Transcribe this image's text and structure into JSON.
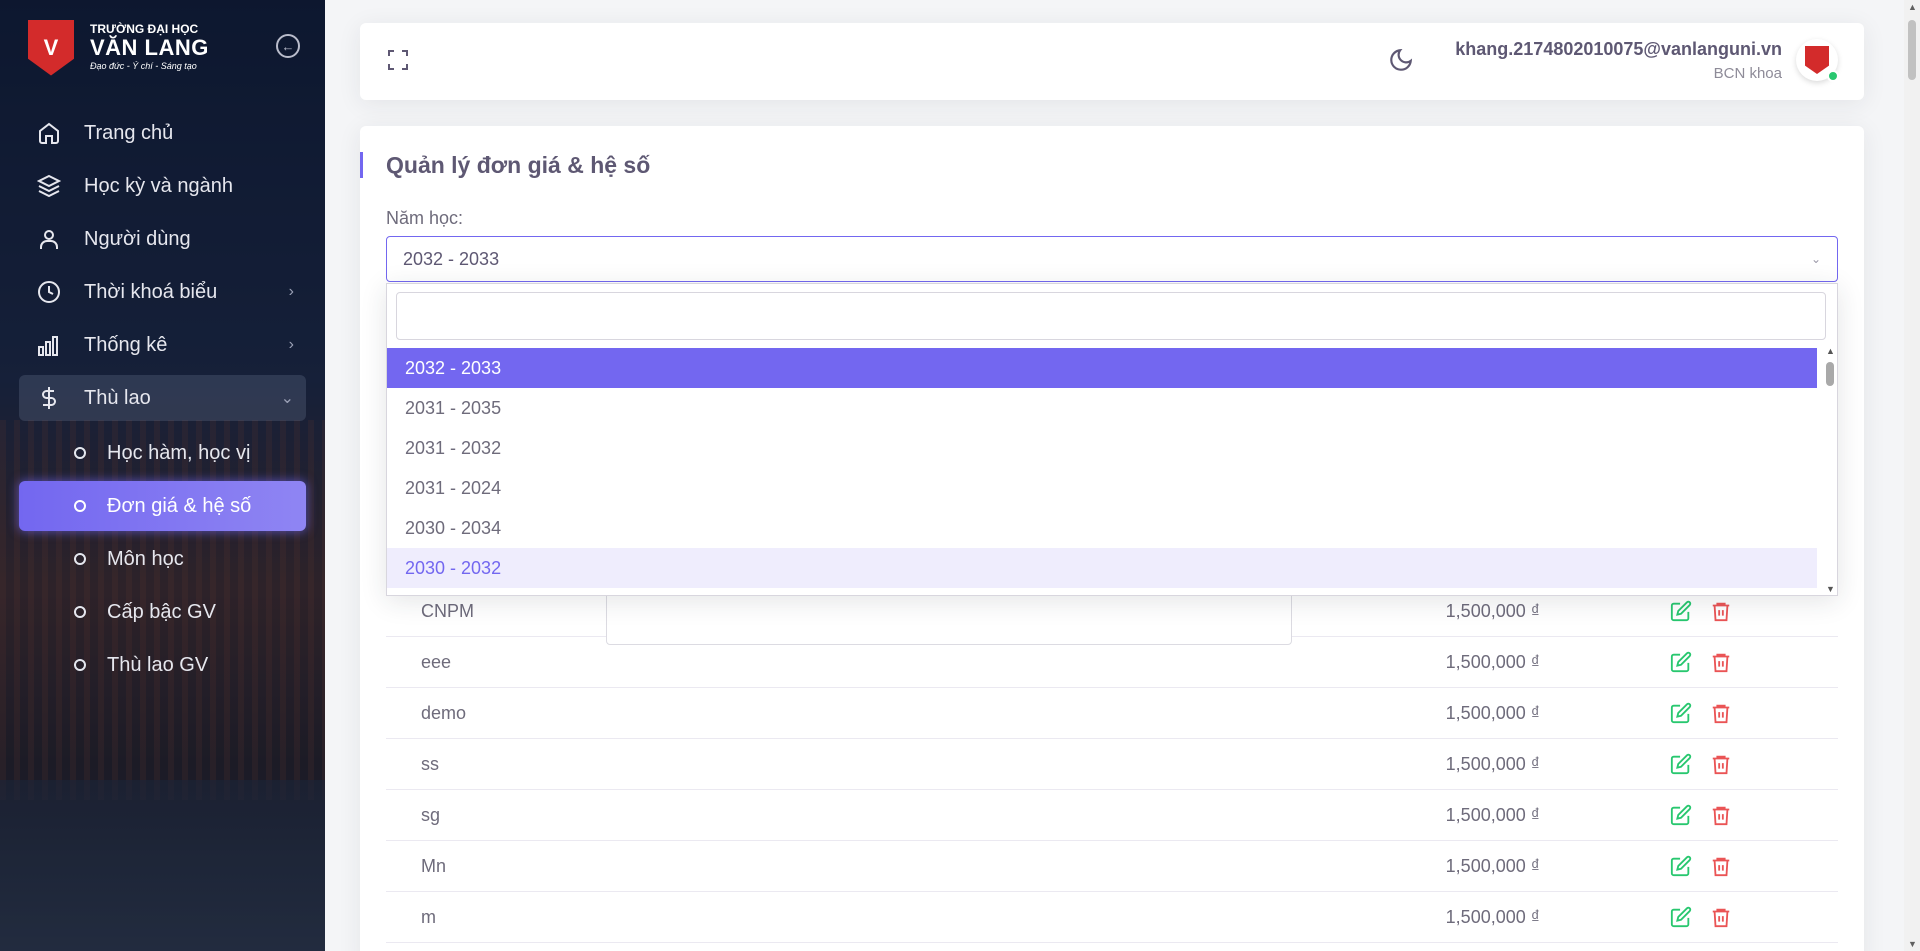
{
  "brand": {
    "line1": "TRƯỜNG ĐẠI HỌC",
    "line2": "VĂN LANG",
    "slogan": "Đạo đức - Ý chí - Sáng tạo",
    "logo_letter": "V"
  },
  "sidebar": {
    "items": [
      {
        "label": "Trang chủ",
        "icon": "home-icon"
      },
      {
        "label": "Học kỳ và ngành",
        "icon": "layers-icon"
      },
      {
        "label": "Người dùng",
        "icon": "user-icon"
      },
      {
        "label": "Thời khoá biểu",
        "icon": "clock-icon"
      },
      {
        "label": "Thống kê",
        "icon": "bar-chart-icon"
      },
      {
        "label": "Thù lao",
        "icon": "dollar-icon"
      }
    ],
    "sub_items": [
      {
        "label": "Học hàm, học vị"
      },
      {
        "label": "Đơn giá & hệ số"
      },
      {
        "label": "Môn học"
      },
      {
        "label": "Cấp bậc GV"
      },
      {
        "label": "Thù lao GV"
      }
    ]
  },
  "header": {
    "user_email": "khang.2174802010075@vanlanguni.vn",
    "user_role": "BCN khoa"
  },
  "page": {
    "title": "Quản lý đơn giá & hệ số",
    "year_label": "Năm học:",
    "selected_year": "2032 - 2033"
  },
  "dropdown": {
    "search_value": "",
    "options": [
      "2032 - 2033",
      "2031 - 2035",
      "2031 - 2032",
      "2031 - 2024",
      "2030 - 2034",
      "2030 - 2032"
    ]
  },
  "table": {
    "rows": [
      {
        "name": "CNPM",
        "price": "1,500,000 ₫"
      },
      {
        "name": "eee",
        "price": "1,500,000 ₫"
      },
      {
        "name": "demo",
        "price": "1,500,000 ₫"
      },
      {
        "name": "ss",
        "price": "1,500,000 ₫"
      },
      {
        "name": "sg",
        "price": "1,500,000 ₫"
      },
      {
        "name": "Mn",
        "price": "1,500,000 ₫"
      },
      {
        "name": "m",
        "price": "1,500,000 ₫"
      }
    ]
  },
  "colors": {
    "primary": "#7367f0",
    "edit": "#28c76f",
    "delete": "#ea5455",
    "logo_red": "#d32b2b"
  }
}
